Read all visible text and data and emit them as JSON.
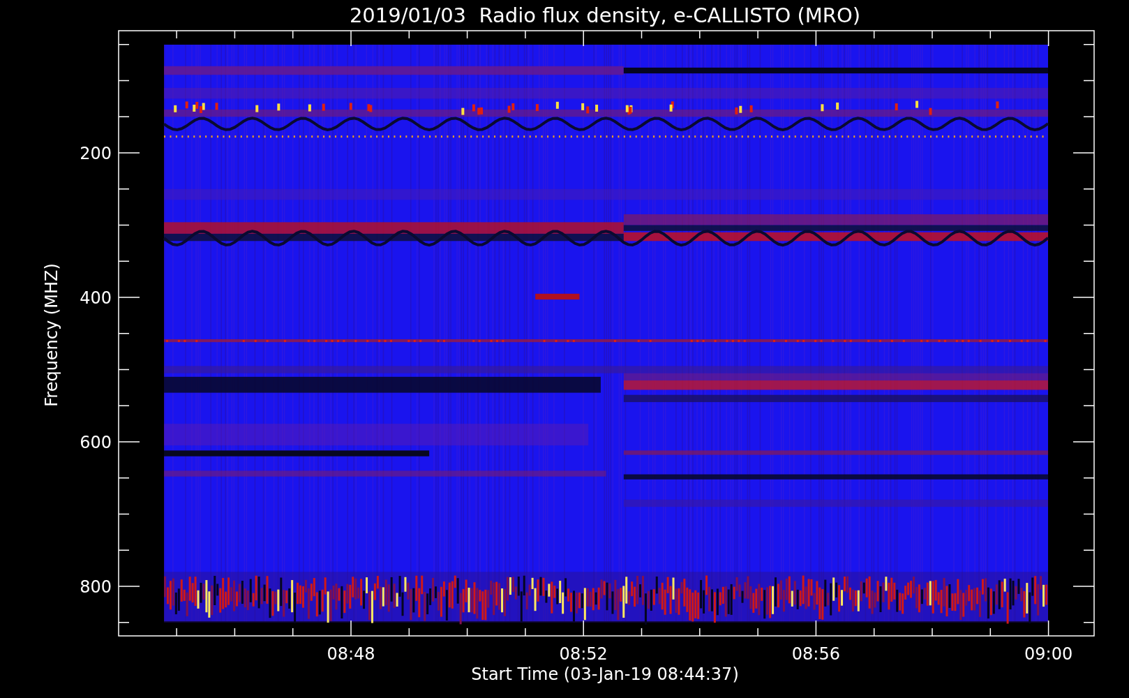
{
  "title": "2019/01/03  Radio flux density, e-CALLISTO (MRO)",
  "y_axis": {
    "label": "Frequency (MHZ)",
    "ticks": [
      "200",
      "400",
      "600",
      "800"
    ]
  },
  "x_axis": {
    "label": "Start Time (03-Jan-19 08:44:37)",
    "ticks": [
      "08:48",
      "08:52",
      "08:56",
      "09:00"
    ]
  }
}
